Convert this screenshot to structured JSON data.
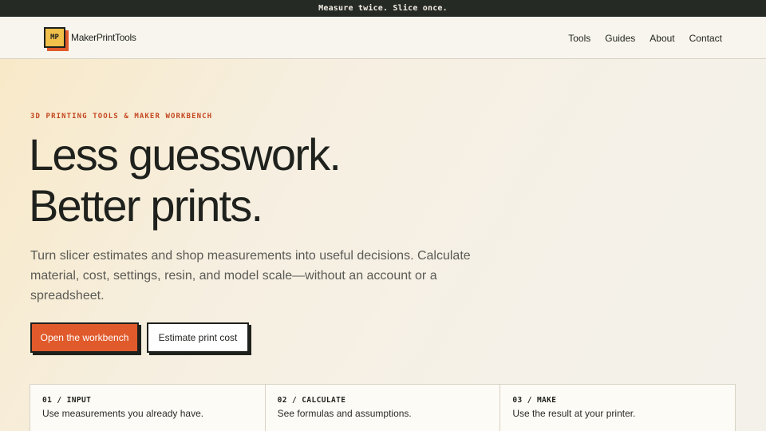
{
  "topbar": {
    "tagline": "Measure twice. Slice once."
  },
  "header": {
    "logo_mark": "MP",
    "brand": "MakerPrintTools",
    "nav": [
      {
        "label": "Tools"
      },
      {
        "label": "Guides"
      },
      {
        "label": "About"
      },
      {
        "label": "Contact"
      }
    ]
  },
  "hero": {
    "eyebrow": "3D PRINTING TOOLS & MAKER WORKBENCH",
    "headline_line1": "Less guesswork.",
    "headline_line2": "Better prints.",
    "lede": "Turn slicer estimates and shop measurements into useful decisions. Calculate material, cost, settings, resin, and model scale—without an account or a spreadsheet.",
    "primary_cta": "Open the workbench",
    "secondary_cta": "Estimate print cost"
  },
  "steps": [
    {
      "label": "01 / INPUT",
      "text": "Use measurements you already have."
    },
    {
      "label": "02 / CALCULATE",
      "text": "See formulas and assumptions."
    },
    {
      "label": "03 / MAKE",
      "text": "Use the result at your printer."
    }
  ],
  "colors": {
    "accent": "#e05a2b",
    "logo_yellow": "#f0c04a",
    "dark": "#262a25"
  }
}
